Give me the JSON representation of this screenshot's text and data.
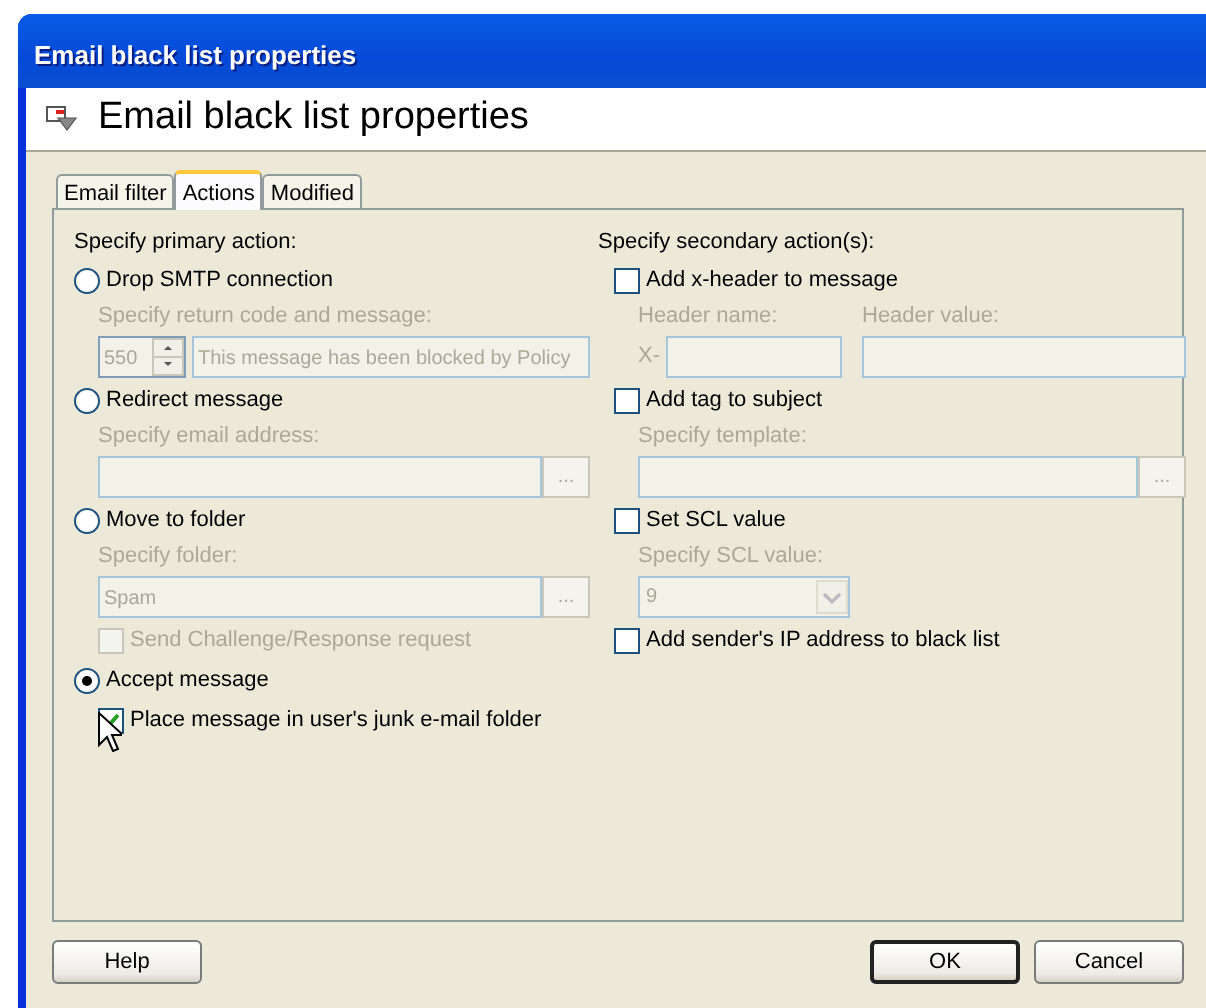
{
  "window": {
    "title": "Email black list properties"
  },
  "header": {
    "title": "Email black list properties"
  },
  "tabs": [
    {
      "label": "Email filter",
      "selected": false
    },
    {
      "label": "Actions",
      "selected": true
    },
    {
      "label": "Modified",
      "selected": false
    }
  ],
  "primary": {
    "label": "Specify primary action:",
    "options": [
      {
        "label": "Drop SMTP connection",
        "selected": false,
        "sub": [
          {
            "kind": "caption",
            "text": "Specify return code and message:",
            "disabled": true
          },
          {
            "kind": "spin_text",
            "value": "550",
            "text": "This message has been blocked by Policy",
            "disabled": true
          }
        ]
      },
      {
        "label": "Redirect message",
        "selected": false,
        "sub": [
          {
            "kind": "caption",
            "text": "Specify email address:",
            "disabled": true
          },
          {
            "kind": "browse",
            "button": "...",
            "disabled": true
          }
        ]
      },
      {
        "label": "Move to folder",
        "selected": false,
        "sub": [
          {
            "kind": "caption",
            "text": "Specify folder:",
            "disabled": true
          },
          {
            "kind": "browse",
            "value": "Spam",
            "button": "...",
            "disabled": true
          },
          {
            "kind": "checkbox",
            "label": "Send Challenge/Response request",
            "checked": false,
            "disabled": true
          }
        ]
      },
      {
        "label": "Accept message",
        "selected": true,
        "sub": [
          {
            "kind": "checkbox",
            "label": "Place message in user's junk e-mail folder",
            "checked": true,
            "disabled": false
          }
        ]
      }
    ]
  },
  "secondary": {
    "label": "Specify secondary action(s):",
    "options": [
      {
        "label": "Add x-header to message",
        "checked": false,
        "sub": [
          {
            "kind": "header_pair",
            "name_label": "Header name:",
            "value_label": "Header value:",
            "prefix": "X-",
            "disabled": true
          }
        ]
      },
      {
        "label": "Add tag to subject",
        "checked": false,
        "sub": [
          {
            "kind": "caption",
            "text": "Specify template:",
            "disabled": true
          },
          {
            "kind": "browse",
            "button": "...",
            "disabled": true
          }
        ]
      },
      {
        "label": "Set SCL value",
        "checked": false,
        "sub": [
          {
            "kind": "caption",
            "text": "Specify SCL value:",
            "disabled": true
          },
          {
            "kind": "combo",
            "value": "9",
            "disabled": true
          }
        ]
      },
      {
        "label": "Add sender's IP address to black list",
        "checked": false
      }
    ]
  },
  "buttons": [
    {
      "label": "Help",
      "default": false
    },
    {
      "label": "OK",
      "default": true
    },
    {
      "label": "Cancel",
      "default": false
    }
  ]
}
